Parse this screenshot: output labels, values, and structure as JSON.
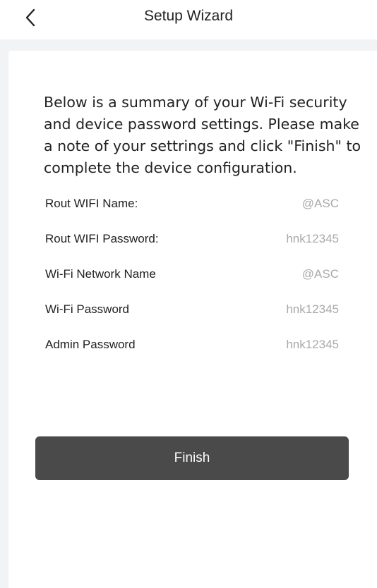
{
  "header": {
    "title": "Setup Wizard",
    "back_icon": "chevron-left-icon"
  },
  "summary_text": "Below is a summary of your Wi-Fi security and device password settings. Please make a note of your settrings and click \"Finish\" to complete the device configuration.",
  "settings": [
    {
      "label": "Rout WIFI Name:",
      "value": "@ASC"
    },
    {
      "label": "Rout WIFI Password:",
      "value": "hnk12345"
    },
    {
      "label": "Wi-Fi Network Name",
      "value": "@ASC"
    },
    {
      "label": "Wi-Fi Password",
      "value": "hnk12345"
    },
    {
      "label": "Admin Password",
      "value": "hnk12345"
    }
  ],
  "finish_label": "Finish",
  "colors": {
    "button_bg": "#4a4a4a",
    "value_text": "#a9a9a9",
    "page_bg": "#f2f3f5"
  }
}
